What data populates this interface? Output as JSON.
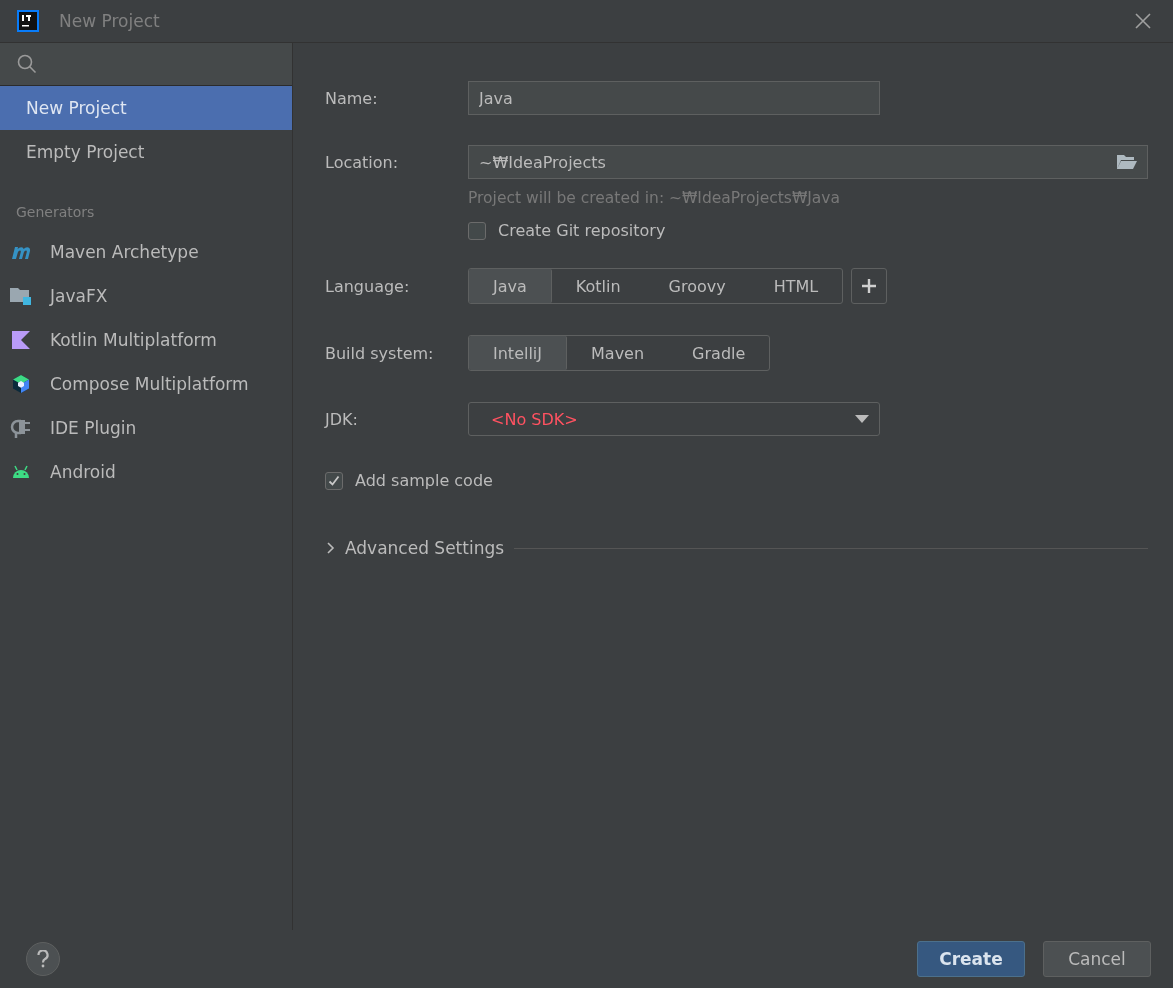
{
  "window": {
    "title": "New Project"
  },
  "sidebar": {
    "items": [
      {
        "label": "New Project",
        "selected": true
      },
      {
        "label": "Empty Project",
        "selected": false
      }
    ],
    "section_title": "Generators",
    "generators": [
      {
        "label": "Maven Archetype",
        "kind": "maven",
        "selected": false
      },
      {
        "label": "JavaFX",
        "kind": "javafx",
        "selected": false
      },
      {
        "label": "Kotlin Multiplatform",
        "kind": "kotlin",
        "selected": false
      },
      {
        "label": "Compose Multiplatform",
        "kind": "compose",
        "selected": false
      },
      {
        "label": "IDE Plugin",
        "kind": "plugin",
        "selected": false
      },
      {
        "label": "Android",
        "kind": "android",
        "selected": false
      }
    ]
  },
  "form": {
    "name": {
      "label": "Name:",
      "value": "Java"
    },
    "location": {
      "label": "Location:",
      "value": "~₩IdeaProjects",
      "hint": "Project will be created in: ~₩IdeaProjects₩Java"
    },
    "git": {
      "label": "Create Git repository",
      "checked": false
    },
    "language": {
      "label": "Language:",
      "options": [
        {
          "label": "Java",
          "selected": true
        },
        {
          "label": "Kotlin",
          "selected": false
        },
        {
          "label": "Groovy",
          "selected": false
        },
        {
          "label": "HTML",
          "selected": false
        }
      ]
    },
    "build_system": {
      "label": "Build system:",
      "options": [
        {
          "label": "IntelliJ",
          "selected": true
        },
        {
          "label": "Maven",
          "selected": false
        },
        {
          "label": "Gradle",
          "selected": false
        }
      ]
    },
    "jdk": {
      "label": "JDK:",
      "value": "<No SDK>"
    },
    "sample_code": {
      "label": "Add sample code",
      "checked": true
    },
    "advanced": {
      "label": "Advanced Settings",
      "expanded": false
    }
  },
  "buttons": [
    {
      "label": "Create",
      "kind": "primary"
    },
    {
      "label": "Cancel",
      "kind": "secondary"
    }
  ]
}
